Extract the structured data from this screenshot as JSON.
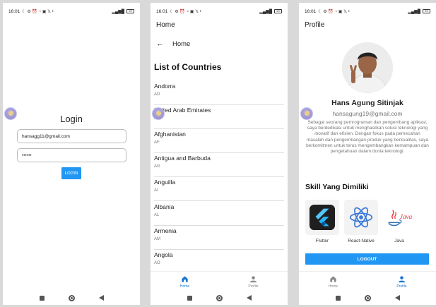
{
  "status_bar": {
    "time": "16:01",
    "left_icons": "☾ ⚙ ⏰ ◔ ▣ 𝕏 •",
    "signal": "▂▄▆█",
    "battery": "99"
  },
  "login_screen": {
    "title": "Login",
    "email_value": "hansagg11@gmail.com",
    "password_value": "••••••",
    "button_label": "LOGIN"
  },
  "home_screen": {
    "appbar_title": "Home",
    "page_title": "Home",
    "list_title": "List of Countries",
    "countries": [
      {
        "name": "Andorra",
        "code": "AD"
      },
      {
        "name": "United Arab Emirates",
        "code": "AE"
      },
      {
        "name": "Afghanistan",
        "code": "AF"
      },
      {
        "name": "Antigua and Barbuda",
        "code": "AG"
      },
      {
        "name": "Anguilla",
        "code": "AI"
      },
      {
        "name": "Albania",
        "code": "AL"
      },
      {
        "name": "Armenia",
        "code": "AM"
      },
      {
        "name": "Angola",
        "code": "AO"
      }
    ]
  },
  "bottom_nav": {
    "home": "Home",
    "profile": "Profile"
  },
  "profile_screen": {
    "appbar_title": "Profile",
    "name": "Hans Agung Sitinjak",
    "email": "hansagung19@gmail.com",
    "bio": "Sebagai seorang pemrograman dan pengembang aplikasi, saya berdedikasi untuk menghasilkan solusi teknologi yang inovatif dan efisien. Dengan fokus pada pemecahan masalah dan pengembangan produk yang berkualitas, saya berkomitmen untuk terus mengembangkan kemampuan dan pengetahuan dalam dunia teknologi.",
    "skills_title": "Skill Yang Dimiliki",
    "skills": [
      {
        "label": "Flutter",
        "icon": "flutter-logo-icon"
      },
      {
        "label": "React-Native",
        "icon": "react-logo-icon"
      },
      {
        "label": "Java",
        "icon": "java-logo-icon"
      }
    ],
    "logout_label": "LOGOUT"
  },
  "colors": {
    "primary": "#2196f3",
    "active_nav": "#1976d2"
  }
}
